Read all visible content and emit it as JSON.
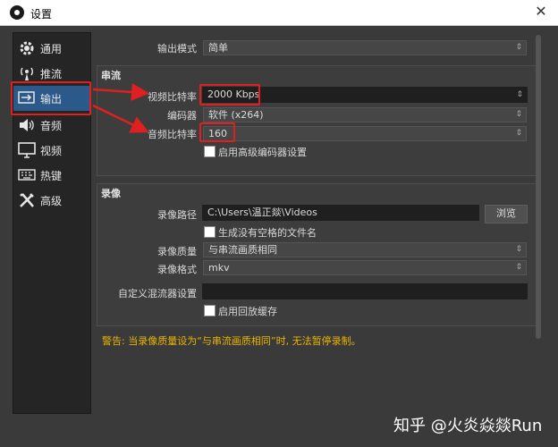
{
  "window": {
    "title": "设置"
  },
  "sidebar": {
    "items": [
      {
        "label": "通用",
        "icon": "gear-icon"
      },
      {
        "label": "推流",
        "icon": "broadcast-icon"
      },
      {
        "label": "输出",
        "icon": "output-icon",
        "active": true
      },
      {
        "label": "音频",
        "icon": "speaker-icon"
      },
      {
        "label": "视频",
        "icon": "monitor-icon"
      },
      {
        "label": "热键",
        "icon": "keyboard-icon"
      },
      {
        "label": "高级",
        "icon": "tools-icon"
      }
    ]
  },
  "output_mode": {
    "label": "输出模式",
    "value": "简单"
  },
  "streaming": {
    "title": "串流",
    "video_bitrate": {
      "label": "视频比特率",
      "value": "2000 Kbps"
    },
    "encoder": {
      "label": "编码器",
      "value": "软件 (x264)"
    },
    "audio_bitrate": {
      "label": "音频比特率",
      "value": "160"
    },
    "advanced_encoder": {
      "label": "启用高级编码器设置",
      "checked": false
    }
  },
  "recording": {
    "title": "录像",
    "path": {
      "label": "录像路径",
      "value": "C:\\Users\\温正燚\\Videos",
      "browse": "浏览"
    },
    "no_space": {
      "label": "生成没有空格的文件名",
      "checked": false
    },
    "quality": {
      "label": "录像质量",
      "value": "与串流画质相同"
    },
    "format": {
      "label": "录像格式",
      "value": "mkv"
    },
    "muxer": {
      "label": "自定义混流器设置",
      "value": ""
    },
    "replay": {
      "label": "启用回放缓存",
      "checked": false
    }
  },
  "warning": "警告: 当录像质量设为“与串流画质相同”时, 无法暂停录制。",
  "watermark": "知乎 @火炎焱燚Run",
  "colors": {
    "accent": "#2b5a8a",
    "highlight": "#e02020",
    "warning": "#e8b400"
  }
}
